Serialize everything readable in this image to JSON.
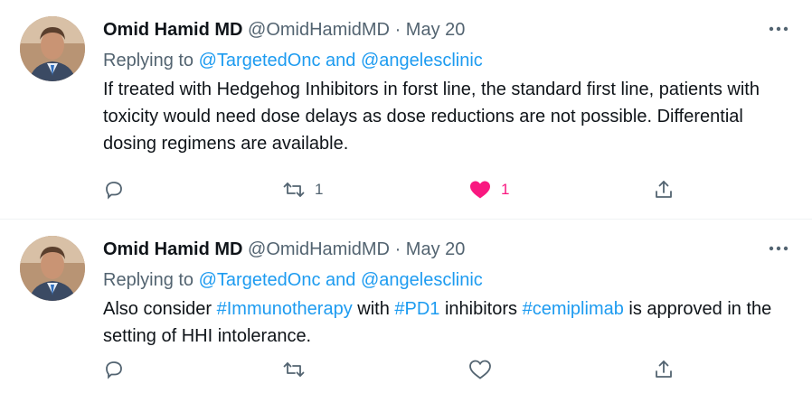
{
  "tweets": [
    {
      "author_name": "Omid Hamid MD",
      "handle": "@OmidHamidMD",
      "separator": "·",
      "date": "May 20",
      "replying_prefix": "Replying to",
      "reply_handle_1": "@TargetedOnc",
      "reply_and": "and",
      "reply_handle_2": "@angelesclinic",
      "body_text": "If treated with Hedgehog Inhibitors in forst line, the standard first line, patients with toxicity would need dose delays as dose reductions are not possible.  Differential dosing regimens are available.",
      "retweet_count": "1",
      "like_count": "1",
      "liked": true
    },
    {
      "author_name": "Omid Hamid MD",
      "handle": "@OmidHamidMD",
      "separator": "·",
      "date": "May 20",
      "replying_prefix": "Replying to",
      "reply_handle_1": "@TargetedOnc",
      "reply_and": "and",
      "reply_handle_2": "@angelesclinic",
      "body_parts": [
        {
          "text": "Also consider ",
          "type": "text"
        },
        {
          "text": "#Immunotherapy",
          "type": "hashtag"
        },
        {
          "text": " with ",
          "type": "text"
        },
        {
          "text": "#PD1",
          "type": "hashtag"
        },
        {
          "text": " inhibitors ",
          "type": "text"
        },
        {
          "text": "#cemiplimab",
          "type": "hashtag"
        },
        {
          "text": " is approved in the setting of HHI intolerance.",
          "type": "text"
        }
      ],
      "retweet_count": "",
      "like_count": "",
      "liked": false
    }
  ],
  "icons": {
    "more": "more-horizontal-icon",
    "reply": "reply-icon",
    "retweet": "retweet-icon",
    "like": "heart-icon",
    "share": "share-icon"
  },
  "colors": {
    "link": "#1d9bf0",
    "muted": "#536471",
    "like_active": "#f91880",
    "text": "#0f1419"
  }
}
